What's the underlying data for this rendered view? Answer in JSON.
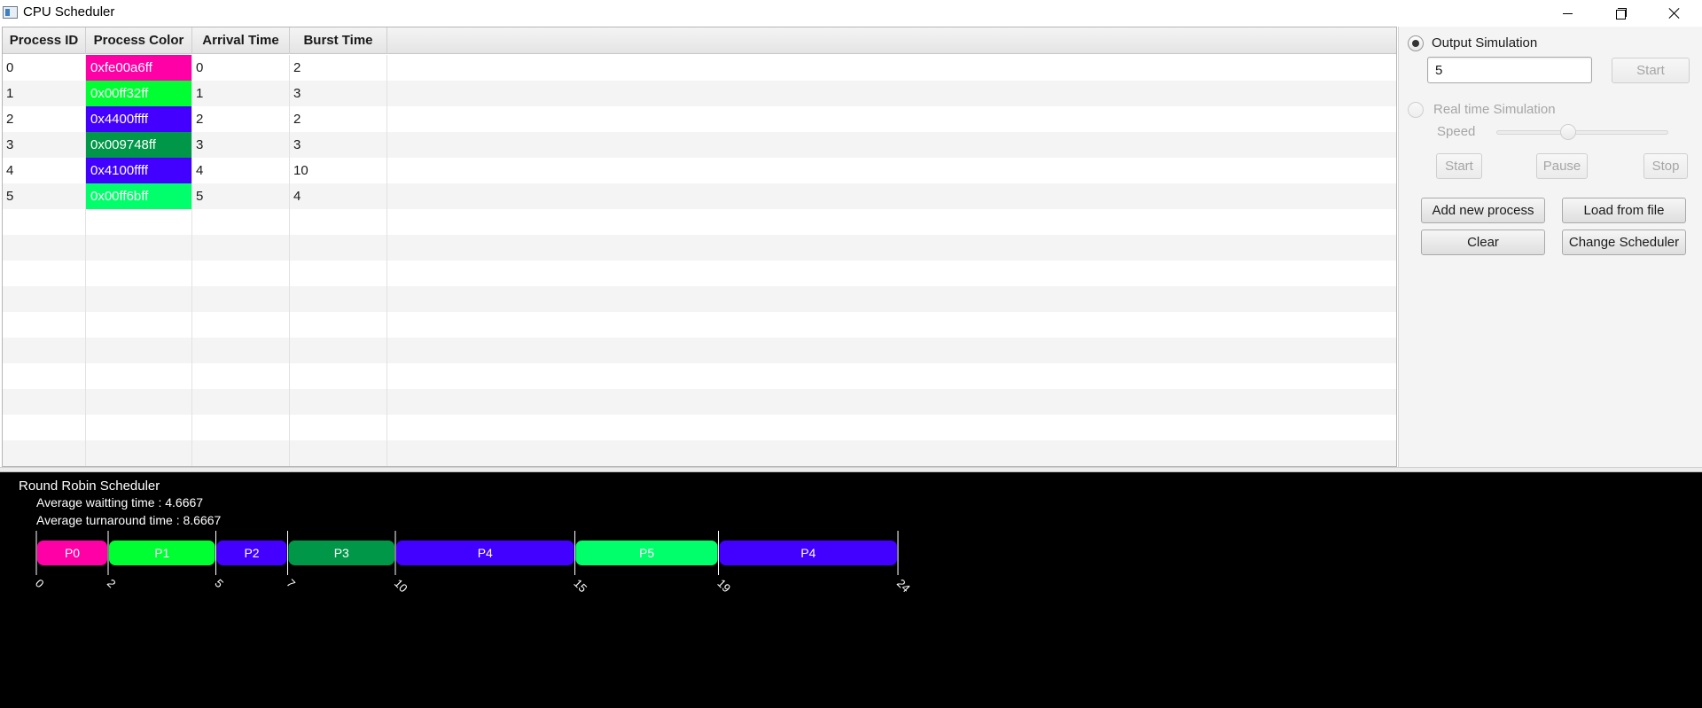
{
  "window": {
    "title": "CPU Scheduler"
  },
  "table": {
    "columns": [
      "Process ID",
      "Process Color",
      "Arrival Time",
      "Burst Time"
    ],
    "rows": [
      {
        "id": "0",
        "color_label": "0xfe00a6ff",
        "color": "#fe00a6",
        "arrival": "0",
        "burst": "2"
      },
      {
        "id": "1",
        "color_label": "0x00ff32ff",
        "color": "#00ff32",
        "arrival": "1",
        "burst": "3"
      },
      {
        "id": "2",
        "color_label": "0x4400ffff",
        "color": "#4400ff",
        "arrival": "2",
        "burst": "2"
      },
      {
        "id": "3",
        "color_label": "0x009748ff",
        "color": "#009748",
        "arrival": "3",
        "burst": "3"
      },
      {
        "id": "4",
        "color_label": "0x4100ffff",
        "color": "#4100ff",
        "arrival": "4",
        "burst": "10"
      },
      {
        "id": "5",
        "color_label": "0x00ff6bff",
        "color": "#00ff6b",
        "arrival": "5",
        "burst": "4"
      }
    ],
    "empty_rows": 10
  },
  "panel": {
    "output_sim_label": "Output Simulation",
    "steps_value": "5",
    "start_label": "Start",
    "realtime_label": "Real time Simulation",
    "speed_label": "Speed",
    "speed_level": 0.4,
    "rt_start_label": "Start",
    "pause_label": "Pause",
    "stop_label": "Stop",
    "add_label": "Add new process",
    "load_label": "Load from file",
    "clear_label": "Clear",
    "change_label": "Change Scheduler"
  },
  "output": {
    "scheduler_name": "Round Robin Scheduler",
    "avg_wait": "Average waitting time : 4.6667",
    "avg_turnaround": "Average turnaround time : 8.6667",
    "gantt": [
      {
        "label": "P0",
        "start": 0,
        "end": 2,
        "color": "#fe00a6"
      },
      {
        "label": "P1",
        "start": 2,
        "end": 5,
        "color": "#00ff32"
      },
      {
        "label": "P2",
        "start": 5,
        "end": 7,
        "color": "#4400ff"
      },
      {
        "label": "P3",
        "start": 7,
        "end": 10,
        "color": "#009748"
      },
      {
        "label": "P4",
        "start": 10,
        "end": 15,
        "color": "#4100ff"
      },
      {
        "label": "P5",
        "start": 15,
        "end": 19,
        "color": "#00ff6b"
      },
      {
        "label": "P4",
        "start": 19,
        "end": 24,
        "color": "#4100ff"
      }
    ],
    "ticks": [
      "0",
      "2",
      "5",
      "7",
      "10",
      "15",
      "19",
      "24"
    ]
  }
}
